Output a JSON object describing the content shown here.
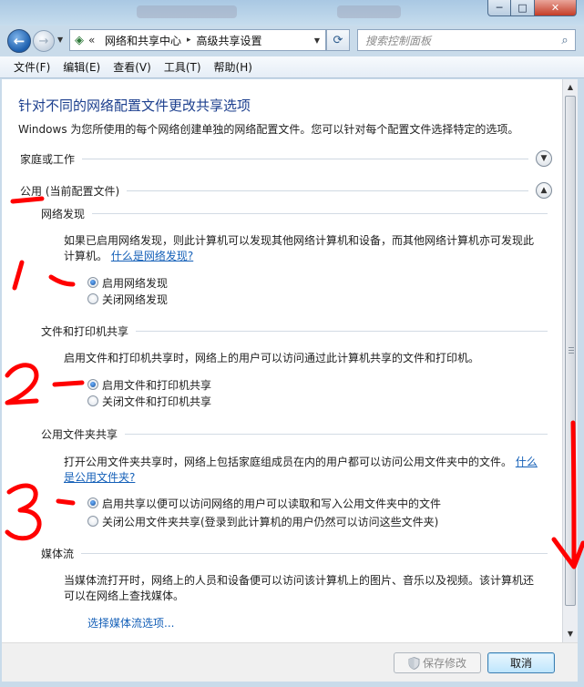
{
  "window": {
    "caption": {
      "minimize": "─",
      "maximize": "□",
      "close": "✕"
    }
  },
  "addressbar": {
    "back_icon": "back-arrow-icon",
    "forward_icon": "forward-arrow-icon",
    "breadcrumb": [
      "网络和共享中心",
      "高级共享设置"
    ],
    "search_placeholder": "搜索控制面板"
  },
  "menu": [
    "文件(F)",
    "编辑(E)",
    "查看(V)",
    "工具(T)",
    "帮助(H)"
  ],
  "page": {
    "title": "针对不同的网络配置文件更改共享选项",
    "subtitle": "Windows 为您所使用的每个网络创建单独的网络配置文件。您可以针对每个配置文件选择特定的选项。"
  },
  "profiles": [
    {
      "label": "家庭或工作",
      "expanded": false
    },
    {
      "label": "公用 (当前配置文件)",
      "expanded": true
    }
  ],
  "sections": [
    {
      "title": "网络发现",
      "desc": "如果已启用网络发现，则此计算机可以发现其他网络计算机和设备，而其他网络计算机亦可发现此计算机。",
      "link": "什么是网络发现?",
      "options": [
        {
          "label": "启用网络发现",
          "selected": true
        },
        {
          "label": "关闭网络发现",
          "selected": false
        }
      ]
    },
    {
      "title": "文件和打印机共享",
      "desc": "启用文件和打印机共享时，网络上的用户可以访问通过此计算机共享的文件和打印机。",
      "options": [
        {
          "label": "启用文件和打印机共享",
          "selected": true
        },
        {
          "label": "关闭文件和打印机共享",
          "selected": false
        }
      ]
    },
    {
      "title": "公用文件夹共享",
      "desc": "打开公用文件夹共享时，网络上包括家庭组成员在内的用户都可以访问公用文件夹中的文件。",
      "link": "什么是公用文件夹?",
      "options": [
        {
          "label": "启用共享以便可以访问网络的用户可以读取和写入公用文件夹中的文件",
          "selected": true
        },
        {
          "label": "关闭公用文件夹共享(登录到此计算机的用户仍然可以访问这些文件夹)",
          "selected": false
        }
      ]
    },
    {
      "title": "媒体流",
      "desc": "当媒体流打开时，网络上的人员和设备便可以访问该计算机上的图片、音乐以及视频。该计算机还可以在网络上查找媒体。",
      "action": "选择媒体流选项..."
    }
  ],
  "buttons": {
    "save": "保存修改",
    "cancel": "取消"
  },
  "annotations": {
    "color": "#ff0000",
    "marks": [
      "1",
      "2",
      "3"
    ]
  }
}
